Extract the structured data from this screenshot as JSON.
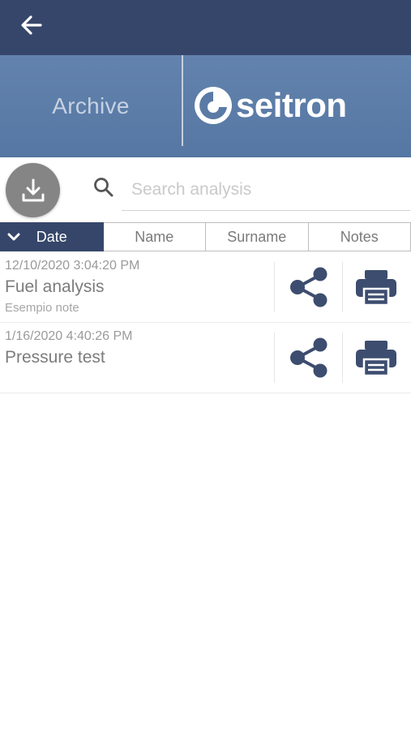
{
  "header": {
    "back_icon": "arrow-left-icon"
  },
  "banner": {
    "title": "Archive",
    "brand": "seitron",
    "brand_icon": "seitron-logo-mark"
  },
  "toolbar": {
    "download_icon": "download-icon",
    "search_icon": "search-icon",
    "search_placeholder": "Search analysis",
    "search_value": ""
  },
  "sort": {
    "active": "Date",
    "active_icon": "chevron-down-icon",
    "columns": [
      "Date",
      "Name",
      "Surname",
      "Notes"
    ]
  },
  "analyses": [
    {
      "date": "12/10/2020 3:04:20 PM",
      "name": "Fuel analysis",
      "notes": "Esempio note",
      "actions": [
        "share-icon",
        "print-icon"
      ]
    },
    {
      "date": "1/16/2020 4:40:26 PM",
      "name": "Pressure test",
      "notes": "",
      "actions": [
        "share-icon",
        "print-icon"
      ]
    }
  ],
  "colors": {
    "header_bg": "#36466a",
    "banner_bg": "#5a7ba6",
    "icon_color": "#3d4d6f",
    "download_bg": "#858585"
  }
}
